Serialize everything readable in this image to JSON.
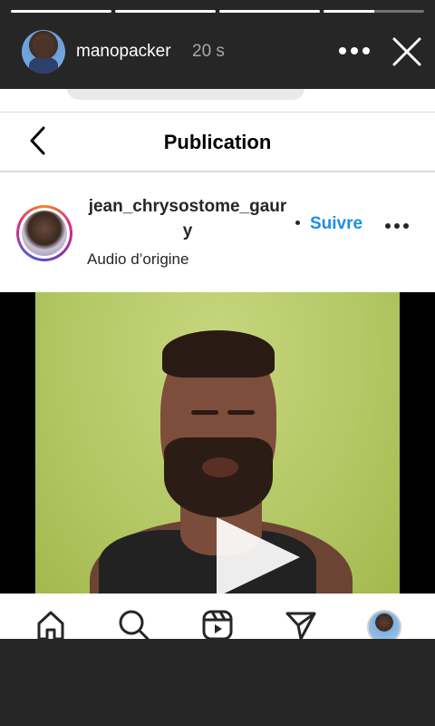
{
  "story": {
    "username": "manopacker",
    "time": "20 s",
    "progress": [
      1,
      1,
      1,
      0.5
    ]
  },
  "post": {
    "nav_title": "Publication",
    "username": "jean_chrysostome_gaury",
    "audio": "Audio d’origine",
    "follow_label": "Suivre"
  },
  "icons": {
    "back": "chevron-left-icon",
    "close": "close-icon",
    "more": "more-horizontal-icon",
    "play": "play-icon",
    "tabs": [
      "home-icon",
      "search-icon",
      "reels-icon",
      "direct-icon",
      "profile-avatar"
    ]
  },
  "colors": {
    "accent": "#1a8fe3",
    "story_bg": "#262626",
    "video_bg": "#b4c865"
  }
}
